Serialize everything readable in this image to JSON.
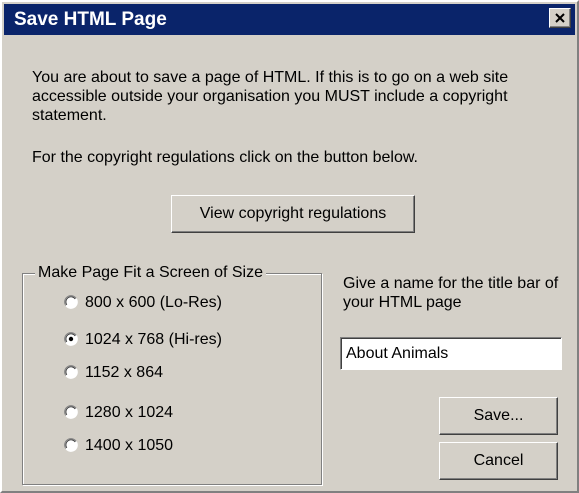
{
  "window": {
    "title": "Save HTML Page"
  },
  "content": {
    "intro": "You are about to save a page of HTML. If this is to go on a web site accessible outside your organisation you MUST include a copyright statement.",
    "copyright_instruction": "For the copyright regulations click on the button below.",
    "view_button_label": "View copyright regulations"
  },
  "screen_size": {
    "legend": "Make Page Fit a Screen of Size",
    "selected_index": 1,
    "options": [
      {
        "label": "800 x 600 (Lo-Res)",
        "checked": false
      },
      {
        "label": "1024 x 768 (Hi-res)",
        "checked": true
      },
      {
        "label": "1152 x 864",
        "checked": false
      },
      {
        "label": "1280 x 1024",
        "checked": false
      },
      {
        "label": "1400 x 1050",
        "checked": false
      }
    ]
  },
  "title_bar_name": {
    "prompt": "Give a name for the title bar of your HTML page",
    "value": "About Animals"
  },
  "buttons": {
    "save_label": "Save...",
    "cancel_label": "Cancel"
  },
  "colors": {
    "titlebar": "#0a246a",
    "face": "#d4d0c8"
  },
  "icons": {
    "close": "close-icon",
    "radio": "radio-button-icon"
  }
}
